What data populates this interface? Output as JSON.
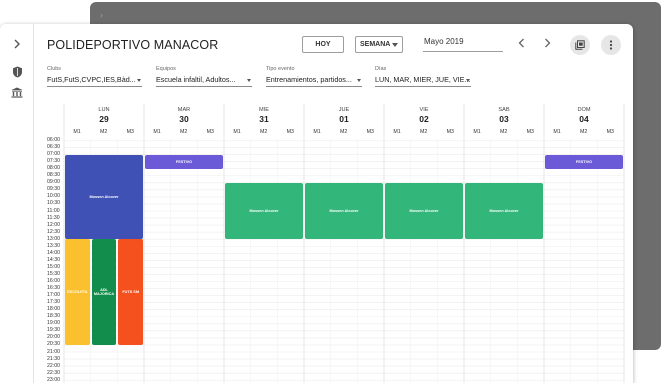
{
  "header": {
    "title": "POLIDEPORTIVO MANACOR",
    "today_label": "HOY",
    "view_select": "SEMANA",
    "date_value": "Mayo 2019"
  },
  "icons": {
    "collapse": "chevron-right-icon",
    "shield": "shield-icon",
    "building": "building-icon",
    "prev": "chevron-left-icon",
    "next": "chevron-right-icon",
    "export": "calendar-export-icon",
    "more": "more-vertical-icon"
  },
  "filters": [
    {
      "label": "Clubs",
      "value": "FutS,FutS,CVPC,IES,Bàd..."
    },
    {
      "label": "Equipos",
      "value": "Escuela infaltil, Adultos..."
    },
    {
      "label": "Tipo evento",
      "value": "Entrenamientos, partidos..."
    },
    {
      "label": "Días",
      "value": "LUN, MAR, MIER, JUE, VIE..."
    }
  ],
  "days": [
    {
      "name": "LUN",
      "date": "29"
    },
    {
      "name": "MAR",
      "date": "30"
    },
    {
      "name": "MIE",
      "date": "31"
    },
    {
      "name": "JUE",
      "date": "01"
    },
    {
      "name": "VIE",
      "date": "02"
    },
    {
      "name": "SAB",
      "date": "03"
    },
    {
      "name": "DOM",
      "date": "04"
    }
  ],
  "subcolumns": [
    "M1",
    "M2",
    "M3"
  ],
  "times": [
    "06:00",
    "06:30",
    "07:00",
    "07:30",
    "08:00",
    "08:30",
    "09:00",
    "09:30",
    "10:00",
    "10:30",
    "11:00",
    "11:30",
    "12:00",
    "12:30",
    "13:00",
    "13:30",
    "14:00",
    "14:30",
    "15:00",
    "15:30",
    "16:00",
    "16:30",
    "17:00",
    "17:30",
    "18:00",
    "18:30",
    "19:00",
    "19:30",
    "20:00",
    "20:30",
    "21:00",
    "21:30",
    "22:00",
    "22:30",
    "23:00"
  ],
  "events": [
    {
      "label": "Mossen Alcover",
      "day": 0,
      "col": 0,
      "span": 3,
      "start": "07:00",
      "end": "13:00",
      "color": "#3f51b5"
    },
    {
      "label": "ESCOLETA",
      "day": 0,
      "col": 0,
      "span": 1,
      "start": "13:00",
      "end": "20:30",
      "color": "#fbc02d"
    },
    {
      "label": "ADL MAJORICA",
      "day": 0,
      "col": 1,
      "span": 1,
      "start": "13:00",
      "end": "20:30",
      "color": "#138d4b"
    },
    {
      "label": "FUTS SM",
      "day": 0,
      "col": 2,
      "span": 1,
      "start": "13:00",
      "end": "20:30",
      "color": "#f4511e"
    },
    {
      "label": "FESTIVO",
      "day": 1,
      "col": 0,
      "span": 3,
      "start": "07:00",
      "end": "08:00",
      "color": "#6a5ad8"
    },
    {
      "label": "Mossen Alcover",
      "day": 2,
      "col": 0,
      "span": 3,
      "start": "09:00",
      "end": "13:00",
      "color": "#33b679"
    },
    {
      "label": "Mossen Alcover",
      "day": 3,
      "col": 0,
      "span": 3,
      "start": "09:00",
      "end": "13:00",
      "color": "#33b679"
    },
    {
      "label": "Mossen Alcover",
      "day": 4,
      "col": 0,
      "span": 3,
      "start": "09:00",
      "end": "13:00",
      "color": "#33b679"
    },
    {
      "label": "Mossen Alcover",
      "day": 5,
      "col": 0,
      "span": 3,
      "start": "09:00",
      "end": "13:00",
      "color": "#33b679"
    },
    {
      "label": "FESTIVO",
      "day": 6,
      "col": 0,
      "span": 3,
      "start": "07:00",
      "end": "08:00",
      "color": "#6a5ad8"
    }
  ]
}
